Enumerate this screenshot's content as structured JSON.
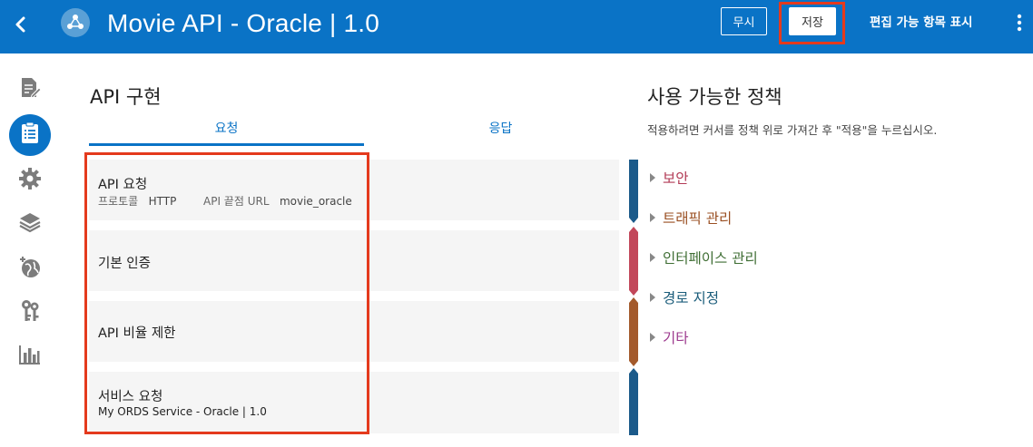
{
  "header": {
    "title": "Movie API - Oracle | 1.0",
    "ignore_label": "무시",
    "save_label": "저장",
    "editable_label": "편집 가능 항목 표시"
  },
  "sidebar": {
    "items": [
      {
        "icon": "document-edit-icon"
      },
      {
        "icon": "api-implementation-icon",
        "active": true
      },
      {
        "icon": "gear-icon"
      },
      {
        "icon": "layers-icon"
      },
      {
        "icon": "globe-icon"
      },
      {
        "icon": "keys-icon"
      },
      {
        "icon": "analytics-icon"
      }
    ]
  },
  "implementation": {
    "heading": "API 구현",
    "tabs": {
      "request": "요청",
      "response": "응답"
    },
    "cards": [
      {
        "title": "API 요청",
        "protocol_label": "프로토콜",
        "protocol_value": "HTTP",
        "endpoint_label": "API 끝점 URL",
        "endpoint_value": "movie_oracle"
      },
      {
        "title": "기본 인증"
      },
      {
        "title": "API 비율 제한"
      },
      {
        "title": "서비스 요청",
        "subtitle": "My ORDS Service - Oracle | 1.0"
      }
    ],
    "stripe_colors": [
      "#1b5a8a",
      "#c2475a",
      "#a35a2c",
      "#1b5a8a"
    ]
  },
  "policies": {
    "heading": "사용 가능한 정책",
    "hint": "적용하려면 커서를 정책 위로 가져간 후 \"적용\"을 누르십시오.",
    "items": [
      {
        "label": "보안",
        "color": "#b23a55"
      },
      {
        "label": "트래픽 관리",
        "color": "#9a4f22"
      },
      {
        "label": "인터페이스 관리",
        "color": "#3f6e34"
      },
      {
        "label": "경로 지정",
        "color": "#1a5c7a"
      },
      {
        "label": "기타",
        "color": "#9d3a8e"
      }
    ]
  },
  "colors": {
    "topbar": "#0a73c6",
    "highlight": "#e43a1d"
  }
}
